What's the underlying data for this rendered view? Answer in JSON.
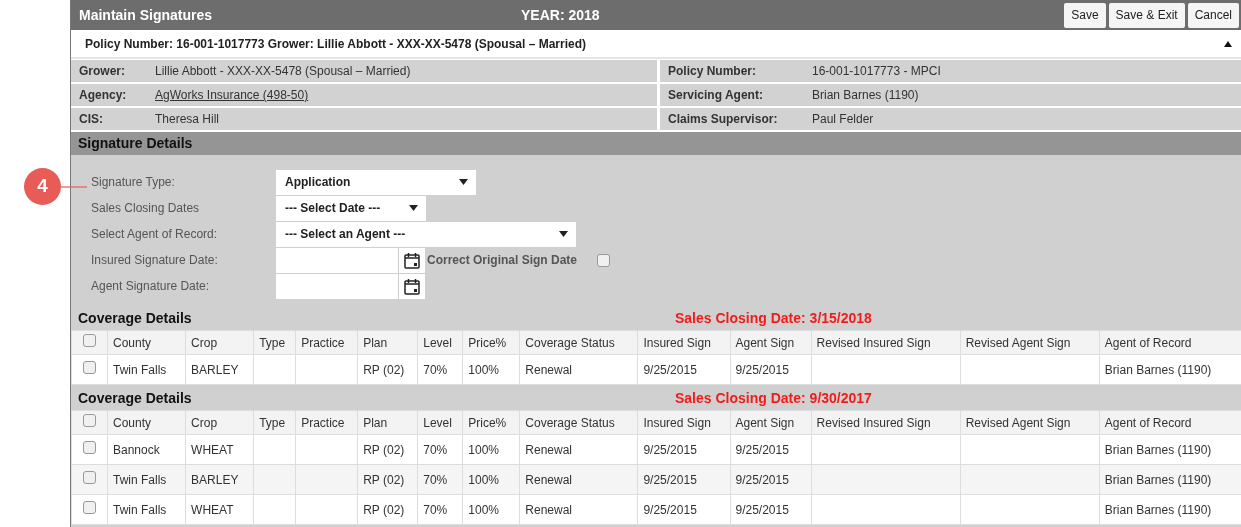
{
  "callout": {
    "number": "4"
  },
  "header": {
    "title": "Maintain Signatures",
    "year": "YEAR: 2018",
    "buttons": [
      "Save",
      "Save & Exit",
      "Cancel"
    ]
  },
  "policy_strip": {
    "text": "Policy Number: 16-001-1017773 Grower: Lillie Abbott - XXX-XX-5478 (Spousal – Married)",
    "expanded": true
  },
  "info": [
    {
      "label": "Grower:",
      "value": "Lillie Abbott - XXX-XX-5478 (Spousal – Married)",
      "kind": "text"
    },
    {
      "label": "Policy Number:",
      "value": "16-001-1017773 - MPCI",
      "kind": "text"
    },
    {
      "label": "Agency:",
      "value": "AgWorks Insurance (498-50)",
      "kind": "link"
    },
    {
      "label": "Servicing Agent:",
      "value": "Brian Barnes (1190)",
      "kind": "text"
    },
    {
      "label": "CIS:",
      "value": "Theresa Hill",
      "kind": "text"
    },
    {
      "label": "Claims Supervisor:",
      "value": "Paul Felder",
      "kind": "text"
    }
  ],
  "signature_details": {
    "title": "Signature Details",
    "fields": [
      {
        "label": "Signature Type:",
        "kind": "select",
        "value": "Application"
      },
      {
        "label": "Sales Closing Dates",
        "kind": "select",
        "value": "--- Select Date ---"
      },
      {
        "label": "Select Agent of Record:",
        "kind": "select",
        "value": "--- Select an Agent ---"
      },
      {
        "label": "Insured Signature Date:",
        "kind": "date",
        "extra_label": "Correct Original Sign Date",
        "checked": false
      },
      {
        "label": "Agent Signature Date:",
        "kind": "date"
      }
    ]
  },
  "coverage_sections": [
    {
      "title": "Coverage Details",
      "closing": "Sales Closing Date: 3/15/2018",
      "all_checked": false,
      "columns": [
        "County",
        "Crop",
        "Type",
        "Practice",
        "Plan",
        "Level",
        "Price%",
        "Coverage Status",
        "Insured Sign",
        "Agent Sign",
        "Revised Insured Sign",
        "Revised Agent Sign",
        "Agent of Record"
      ],
      "rows": [
        {
          "checked": false,
          "cells": [
            "Twin Falls",
            "BARLEY",
            "",
            "",
            "RP (02)",
            "70%",
            "100%",
            "Renewal",
            "9/25/2015",
            "9/25/2015",
            "",
            "",
            "Brian Barnes (1190)"
          ]
        }
      ]
    },
    {
      "title": "Coverage Details",
      "closing": "Sales Closing Date: 9/30/2017",
      "all_checked": false,
      "columns": [
        "County",
        "Crop",
        "Type",
        "Practice",
        "Plan",
        "Level",
        "Price%",
        "Coverage Status",
        "Insured Sign",
        "Agent Sign",
        "Revised Insured Sign",
        "Revised Agent Sign",
        "Agent of Record"
      ],
      "rows": [
        {
          "checked": false,
          "cells": [
            "Bannock",
            "WHEAT",
            "",
            "",
            "RP (02)",
            "70%",
            "100%",
            "Renewal",
            "9/25/2015",
            "9/25/2015",
            "",
            "",
            "Brian Barnes (1190)"
          ]
        },
        {
          "checked": false,
          "cells": [
            "Twin Falls",
            "BARLEY",
            "",
            "",
            "RP (02)",
            "70%",
            "100%",
            "Renewal",
            "9/25/2015",
            "9/25/2015",
            "",
            "",
            "Brian Barnes (1190)"
          ]
        },
        {
          "checked": false,
          "cells": [
            "Twin Falls",
            "WHEAT",
            "",
            "",
            "RP (02)",
            "70%",
            "100%",
            "Renewal",
            "9/25/2015",
            "9/25/2015",
            "",
            "",
            "Brian Barnes (1190)"
          ]
        }
      ]
    }
  ]
}
